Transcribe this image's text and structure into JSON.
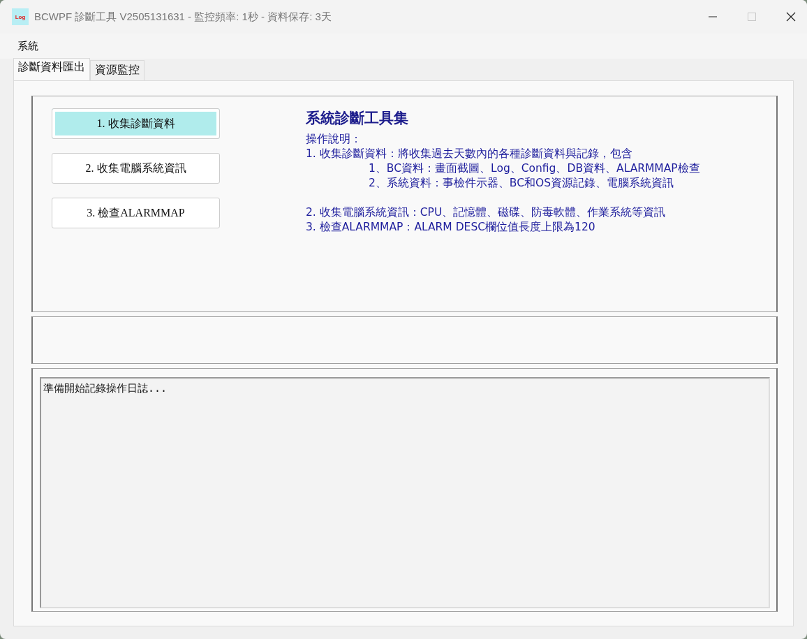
{
  "window": {
    "title": "BCWPF 診斷工具 V2505131631 - 監控頻率: 1秒 - 資料保存: 3天",
    "app_icon": "Log",
    "maximize_disabled": true
  },
  "menu": [
    {
      "label": "系統"
    }
  ],
  "tabs": [
    {
      "label": "診斷資料匯出",
      "selected": true
    },
    {
      "label": "資源監控",
      "selected": false
    }
  ],
  "actions": [
    {
      "label": "1. 收集診斷資料",
      "highlighted": true
    },
    {
      "label": "2. 收集電腦系統資訊",
      "highlighted": false
    },
    {
      "label": "3. 檢查ALARMMAP",
      "highlighted": false
    }
  ],
  "info": {
    "title": "系統診斷工具集",
    "intro": "操作說明：",
    "items": [
      {
        "text": "1. 收集診斷資料：將收集過去天數內的各種診斷資料與記錄，包含",
        "children": [
          {
            "text": "1、BC資料：畫面截圖、Log、Config、DB資料、ALARMMAP檢查"
          },
          {
            "text": "2、系統資料：事檢件示器、BC和OS資源記錄、電腦系統資訊"
          }
        ]
      },
      {
        "text": "2. 收集電腦系統資訊：CPU、記憶體、磁碟、防毒軟體、作業系統等資訊"
      },
      {
        "text": "3. 檢查ALARMMAP：ALARM DESC欄位值長度上限為120"
      }
    ]
  },
  "log": {
    "lines": [
      "準備開始記錄操作日誌..."
    ]
  }
}
